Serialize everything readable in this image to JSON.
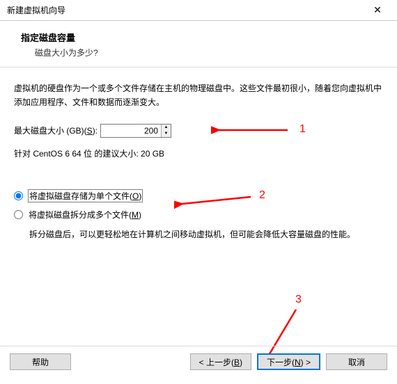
{
  "titlebar": {
    "title": "新建虚拟机向导",
    "close": "✕"
  },
  "header": {
    "title": "指定磁盘容量",
    "subtitle": "磁盘大小为多少?"
  },
  "content": {
    "description": "虚拟机的硬盘作为一个或多个文件存储在主机的物理磁盘中。这些文件最初很小，随着您向虚拟机中添加应用程序、文件和数据而逐渐变大。",
    "sizeLabel": "最大磁盘大小 (GB)(",
    "sizeMnemonic": "S",
    "sizeLabelEnd": "):",
    "sizeValue": "200",
    "recommend": "针对 CentOS 6 64 位 的建议大小: 20 GB",
    "radio1_pre": "将虚拟磁盘存储为单个文件(",
    "radio1_m": "O",
    "radio1_post": ")",
    "radio2_pre": "将虚拟磁盘拆分成多个文件(",
    "radio2_m": "M",
    "radio2_post": ")",
    "splitDesc": "拆分磁盘后，可以更轻松地在计算机之间移动虚拟机，但可能会降低大容量磁盘的性能。"
  },
  "buttons": {
    "help": "帮助",
    "back_pre": "< 上一步(",
    "back_m": "B",
    "back_post": ")",
    "next_pre": "下一步(",
    "next_m": "N",
    "next_post": ") >",
    "cancel": "取消"
  },
  "annotations": {
    "n1": "1",
    "n2": "2",
    "n3": "3"
  }
}
